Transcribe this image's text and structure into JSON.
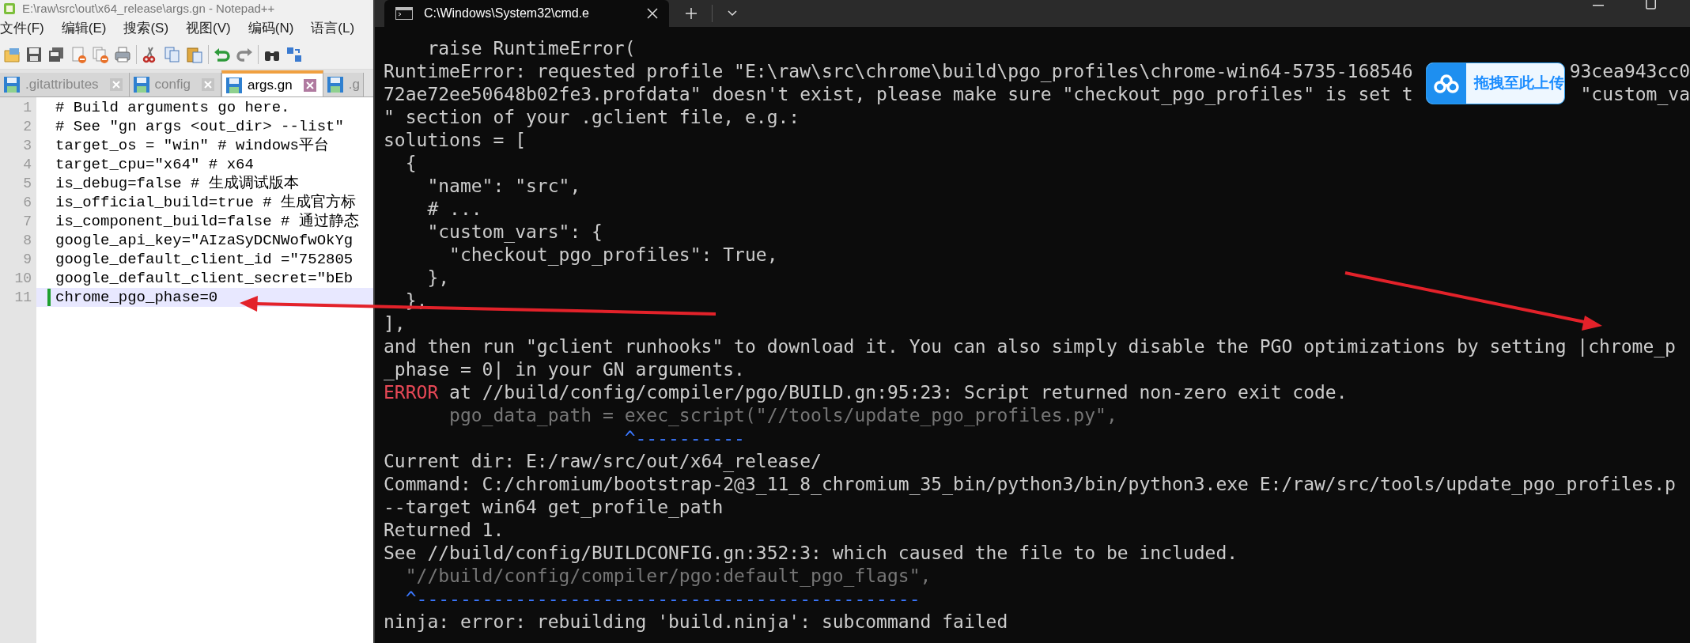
{
  "notepad": {
    "title": "E:\\raw\\src\\out\\x64_release\\args.gn - Notepad++",
    "menu": [
      "文件(F)",
      "编辑(E)",
      "搜索(S)",
      "视图(V)",
      "编码(N)",
      "语言(L)"
    ],
    "tabs": [
      {
        "label": ".gitattributes",
        "selected": false
      },
      {
        "label": "config",
        "selected": false
      },
      {
        "label": "args.gn",
        "selected": true
      },
      {
        "label": ".g",
        "selected": false
      }
    ],
    "lines": [
      {
        "number": "1",
        "text": "# Build arguments go here.",
        "current": false
      },
      {
        "number": "2",
        "text": "# See \"gn args <out_dir> --list\"",
        "current": false
      },
      {
        "number": "3",
        "text": "target_os = \"win\" # windows平台",
        "current": false
      },
      {
        "number": "4",
        "text": "target_cpu=\"x64\" # x64",
        "current": false
      },
      {
        "number": "5",
        "text": "is_debug=false # 生成调试版本",
        "current": false
      },
      {
        "number": "6",
        "text": "is_official_build=true # 生成官方标",
        "current": false
      },
      {
        "number": "7",
        "text": "is_component_build=false # 通过静态",
        "current": false
      },
      {
        "number": "8",
        "text": "google_api_key=\"AIzaSyDCNWofwOkYg",
        "current": false
      },
      {
        "number": "9",
        "text": "google_default_client_id =\"752805",
        "current": false
      },
      {
        "number": "10",
        "text": "google_default_client_secret=\"bEb",
        "current": false
      },
      {
        "number": "11",
        "text": "chrome_pgo_phase=0",
        "current": true
      }
    ]
  },
  "terminal": {
    "tab_title": "C:\\Windows\\System32\\cmd.e",
    "lines": [
      {
        "kind": "plain",
        "text": "    raise RuntimeError("
      },
      {
        "kind": "plain",
        "text": "RuntimeError: requested profile \"E:\\raw\\src\\chrome\\build\\pgo_profiles\\chrome-win64-5735-168546",
        "tail": "93cea943cc0"
      },
      {
        "kind": "plain",
        "text": "72ae72ee50648b02fe3.profdata\" doesn't exist, please make sure \"checkout_pgo_profiles\" is set t",
        "tail": "\"custom_va"
      },
      {
        "kind": "plain",
        "text": "\" section of your .gclient file, e.g.:"
      },
      {
        "kind": "plain",
        "text": "solutions = ["
      },
      {
        "kind": "plain",
        "text": "  {"
      },
      {
        "kind": "plain",
        "text": "    \"name\": \"src\","
      },
      {
        "kind": "plain",
        "text": "    # ..."
      },
      {
        "kind": "plain",
        "text": "    \"custom_vars\": {"
      },
      {
        "kind": "plain",
        "text": "      \"checkout_pgo_profiles\": True,"
      },
      {
        "kind": "plain",
        "text": "    },"
      },
      {
        "kind": "plain",
        "text": "  },"
      },
      {
        "kind": "plain",
        "text": "],"
      },
      {
        "kind": "plain",
        "text": "and then run \"gclient runhooks\" to download it. You can also simply disable the PGO optimizations by setting |chrome_p"
      },
      {
        "kind": "plain",
        "text": "_phase = 0| in your GN arguments."
      },
      {
        "kind": "error",
        "label": "ERROR",
        "text": " at //build/config/compiler/pgo/BUILD.gn:95:23: Script returned non-zero exit code."
      },
      {
        "kind": "dim",
        "text": "      pgo_data_path = exec_script(\"//tools/update_pgo_profiles.py\","
      },
      {
        "kind": "caret",
        "text": "                      ^----------"
      },
      {
        "kind": "plain",
        "text": "Current dir: E:/raw/src/out/x64_release/"
      },
      {
        "kind": "plain",
        "text": "Command: C:/chromium/bootstrap-2@3_11_8_chromium_35_bin/python3/bin/python3.exe E:/raw/src/tools/update_pgo_profiles.p"
      },
      {
        "kind": "plain",
        "text": "--target win64 get_profile_path"
      },
      {
        "kind": "plain",
        "text": "Returned 1."
      },
      {
        "kind": "plain",
        "text": "See //build/config/BUILDCONFIG.gn:352:3: which caused the file to be included."
      },
      {
        "kind": "dim",
        "text": "  \"//build/config/compiler/pgo:default_pgo_flags\","
      },
      {
        "kind": "caret",
        "text": "  ^----------------------------------------------"
      },
      {
        "kind": "plain",
        "text": "ninja: error: rebuilding 'build.ninja': subcommand failed"
      }
    ]
  },
  "upload_widget": {
    "label": "拖拽至此上传"
  }
}
